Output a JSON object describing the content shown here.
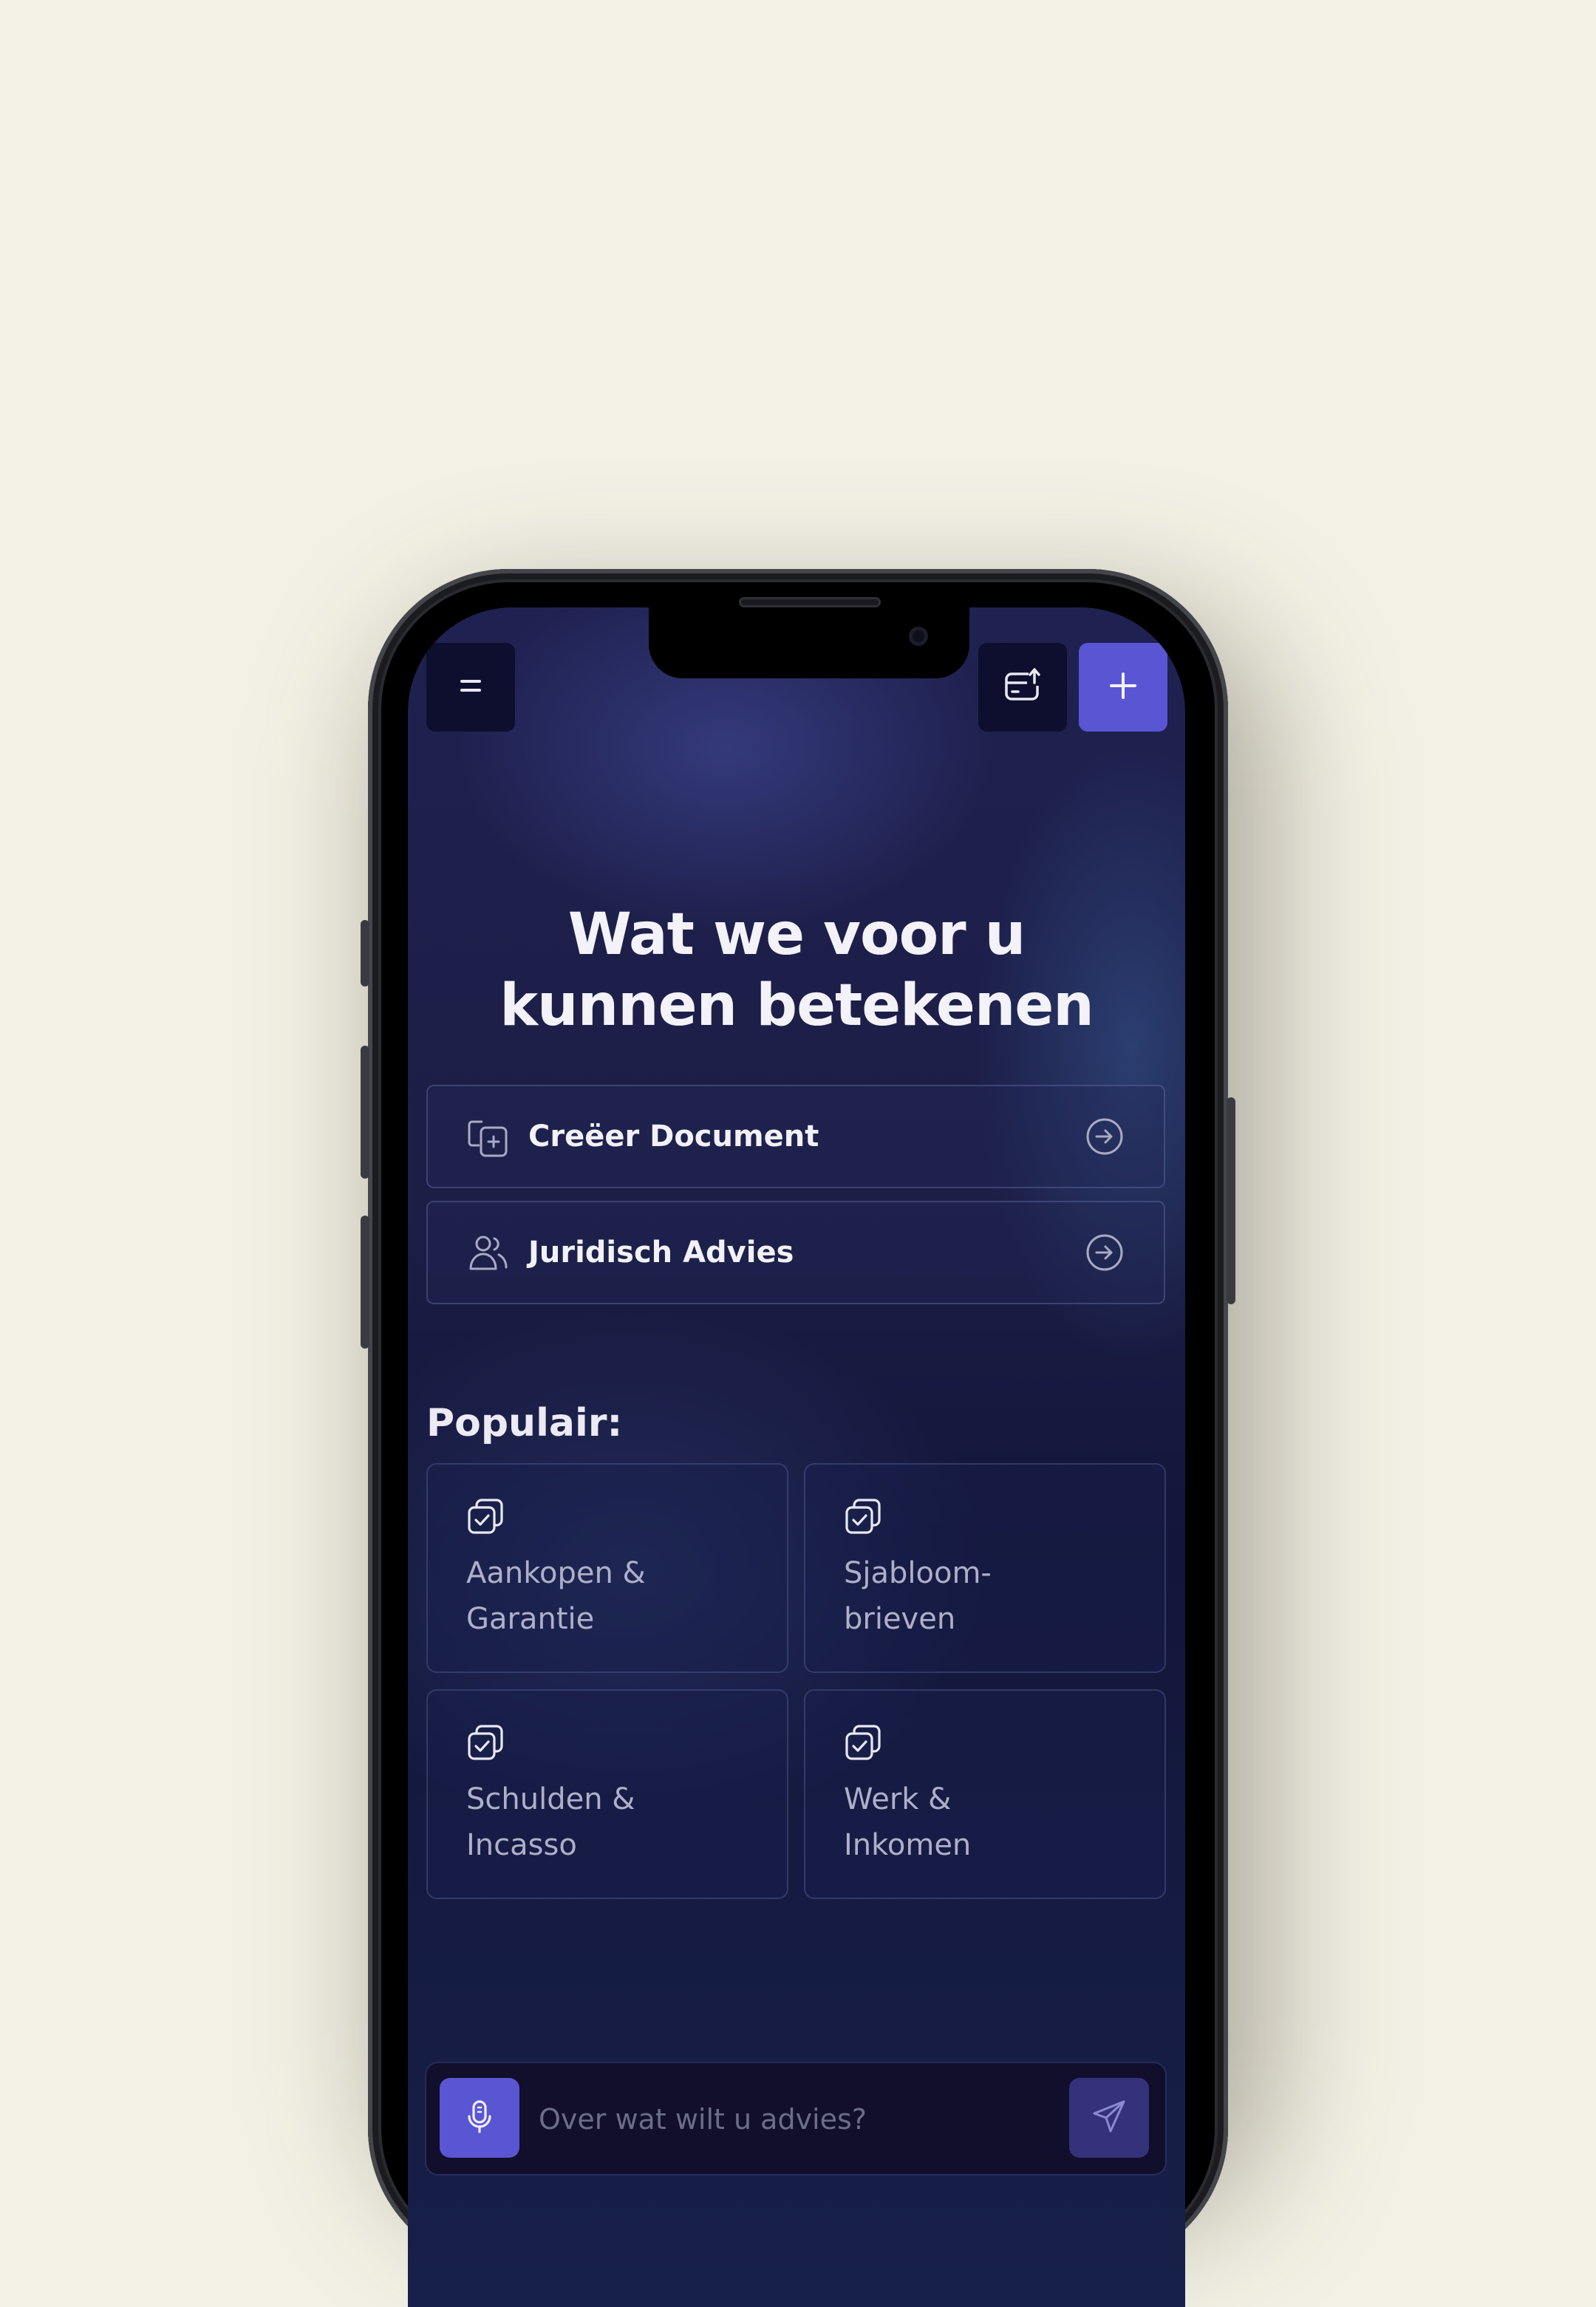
{
  "header": {
    "menu_icon": "menu-icon",
    "export_icon": "export-icon",
    "new_icon": "plus-icon"
  },
  "hero": {
    "title_line1": "Wat we voor u",
    "title_line2": "kunnen betekenen"
  },
  "actions": [
    {
      "label": "Creëer Document",
      "icon": "document-add-icon",
      "arrow": "arrow-right-circle-icon"
    },
    {
      "label": "Juridisch Advies",
      "icon": "users-icon",
      "arrow": "arrow-right-circle-icon"
    }
  ],
  "popular": {
    "title": "Populair:",
    "items": [
      {
        "line1": "Aankopen &",
        "line2": "Garantie",
        "icon": "copy-check-icon"
      },
      {
        "line1": "Sjabloom-",
        "line2": "brieven",
        "icon": "copy-check-icon"
      },
      {
        "line1": "Schulden &",
        "line2": "Incasso",
        "icon": "copy-check-icon"
      },
      {
        "line1": "Werk &",
        "line2": "Inkomen",
        "icon": "copy-check-icon"
      }
    ]
  },
  "chat": {
    "placeholder": "Over wat wilt u advies?",
    "mic_icon": "microphone-icon",
    "send_icon": "send-icon"
  },
  "colors": {
    "background": "#f3f1e5",
    "accent": "#5a55d3",
    "screen_dark": "#13163a"
  }
}
